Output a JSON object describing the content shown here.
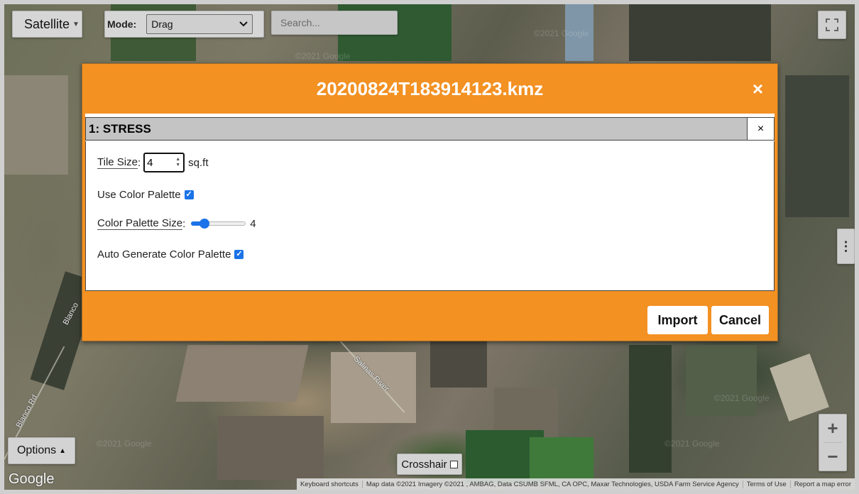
{
  "map": {
    "labels": [
      "Salinas River",
      "Blanco Rd",
      "Blanco"
    ],
    "watermarks": [
      "©2021 Google",
      "©2021 Google",
      "©2021 Google",
      "©2021 Google",
      "©2021 Google"
    ],
    "google_logo": "Google",
    "attribution": [
      "Keyboard shortcuts",
      "Map data ©2021 Imagery ©2021 , AMBAG, Data CSUMB SFML, CA OPC, Maxar Technologies, USDA Farm Service Agency",
      "Terms of Use",
      "Report a map error"
    ]
  },
  "controls": {
    "satellite_label": "Satellite",
    "mode_label": "Mode:",
    "mode_value": "Drag",
    "search_placeholder": "Search...",
    "options_label": "Options",
    "crosshair_label": "Crosshair",
    "zoom_in": "+",
    "zoom_out": "−",
    "side_handle": "⋮"
  },
  "dialog": {
    "title": "20200824T183914123.kmz",
    "close_glyph": "×",
    "layer": {
      "name": "1: STRESS",
      "remove_glyph": "×",
      "tile_size_label": "Tile Size",
      "tile_size_value": "4",
      "tile_size_unit": "sq.ft",
      "use_palette_label": "Use Color Palette",
      "use_palette_checked": true,
      "palette_size_label": "Color Palette Size",
      "palette_size_value": "4",
      "palette_slider_fraction": 0.2,
      "auto_palette_label": "Auto Generate Color Palette",
      "auto_palette_checked": true
    },
    "import_label": "Import",
    "cancel_label": "Cancel"
  },
  "colors": {
    "dialog_accent": "#f39123",
    "checkbox": "#1a73e8"
  }
}
